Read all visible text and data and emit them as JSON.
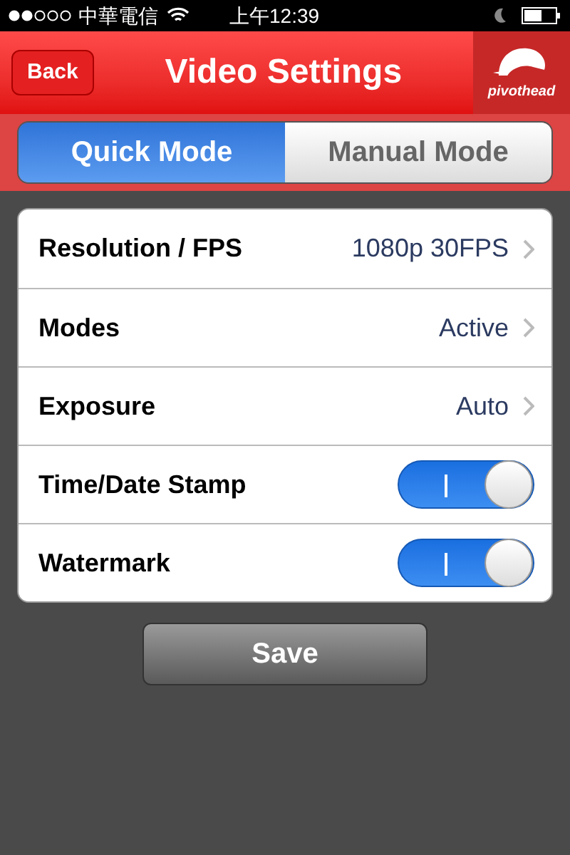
{
  "status_bar": {
    "carrier": "中華電信",
    "time": "上午12:39"
  },
  "nav": {
    "back": "Back",
    "title": "Video Settings",
    "logo": "pivothead"
  },
  "tabs": [
    {
      "label": "Quick Mode",
      "selected": true
    },
    {
      "label": "Manual Mode",
      "selected": false
    }
  ],
  "settings": [
    {
      "kind": "link",
      "label": "Resolution / FPS",
      "value": "1080p 30FPS"
    },
    {
      "kind": "link",
      "label": "Modes",
      "value": "Active"
    },
    {
      "kind": "link",
      "label": "Exposure",
      "value": "Auto"
    },
    {
      "kind": "toggle",
      "label": "Time/Date Stamp",
      "on": true
    },
    {
      "kind": "toggle",
      "label": "Watermark",
      "on": true
    }
  ],
  "save": "Save"
}
